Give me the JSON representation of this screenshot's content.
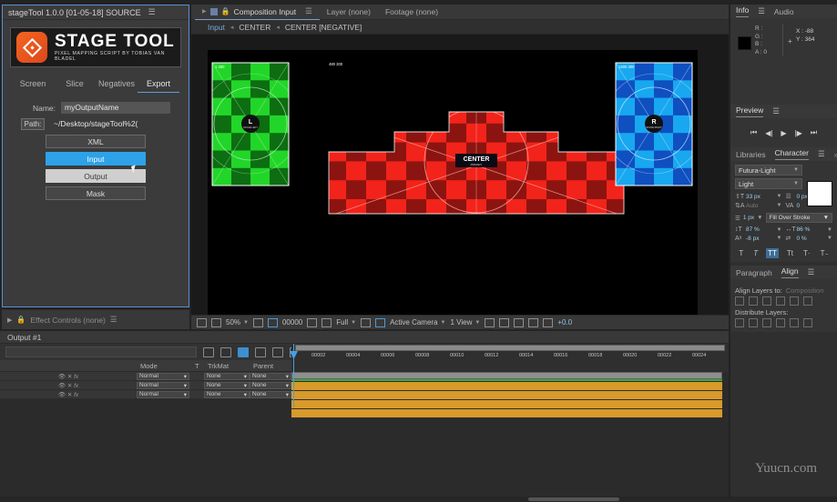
{
  "script_panel": {
    "title": "stageTool 1.0.0 [01-05-18] SOURCE",
    "menu_icon": "hamburger-icon",
    "logo": {
      "title": "STAGE TOOL",
      "subtitle": "PIXEL MAPPING SCRIPT BY TOBIAS VAN BLADEL"
    },
    "tabs": [
      {
        "label": "Screen",
        "active": false
      },
      {
        "label": "Slice",
        "active": false
      },
      {
        "label": "Negatives",
        "active": false
      },
      {
        "label": "Export",
        "active": true
      }
    ],
    "fields": [
      {
        "label": "Name:",
        "value": "myOutputName"
      },
      {
        "label": "Path:",
        "value": "~/Desktop/stageTool%2("
      }
    ],
    "buttons": [
      {
        "label": "XML",
        "style": "default"
      },
      {
        "label": "Input",
        "style": "blue"
      },
      {
        "label": "Output",
        "style": "light"
      },
      {
        "label": "Mask",
        "style": "default"
      }
    ]
  },
  "effect_controls": {
    "label": "Effect Controls (none)",
    "menu_icon": "hamburger-icon"
  },
  "comp_viewer": {
    "tabs": [
      {
        "label": "Composition Input",
        "active": true
      },
      {
        "label": "Layer (none)",
        "active": false
      },
      {
        "label": "Footage (none)",
        "active": false
      }
    ],
    "breadcrumb": [
      "Input",
      "CENTER",
      "CENTER [NEGATIVE]"
    ],
    "canvas": {
      "dimension_label": "480 300",
      "screens": [
        {
          "name": "green-screen-left",
          "label": "1 300",
          "badge_glyph": "L",
          "badge_caption": "STAGE LEFT",
          "color_light": "#22d629",
          "color_dark": "#0c6d11"
        },
        {
          "name": "red-screen-center",
          "label": "480 300",
          "tag_title": "CENTER",
          "tag_sub": "PRIMARY",
          "color_light": "#f2231a",
          "color_dark": "#8c1410"
        },
        {
          "name": "blue-screen-right",
          "label": "1400 300",
          "badge_glyph": "R",
          "badge_caption": "STAGE RIGHT",
          "color_light": "#18a8f0",
          "color_dark": "#0f4fc0"
        }
      ]
    },
    "toolbar": {
      "zoom": "50%",
      "timecode": "00000",
      "resolution": "Full",
      "camera": "Active Camera",
      "views": "1 View",
      "exposure": "+0.0"
    }
  },
  "timeline": {
    "tab_label": "Output #1",
    "columns": [
      "Mode",
      "T",
      "TrkMat",
      "Parent"
    ],
    "layers": [
      {
        "mode": "Normal",
        "trkmat": "None",
        "parent": "None"
      },
      {
        "mode": "Normal",
        "trkmat": "None",
        "parent": "None"
      },
      {
        "mode": "Normal",
        "trkmat": "None",
        "parent": "None"
      }
    ],
    "ruler_ticks": [
      "00002",
      "00004",
      "00006",
      "00008",
      "00010",
      "00012",
      "00014",
      "00016",
      "00018",
      "00020",
      "00022",
      "00024"
    ]
  },
  "info_panel": {
    "tabs": [
      {
        "label": "Info",
        "active": true
      },
      {
        "label": "Audio",
        "active": false
      }
    ],
    "channels": [
      "R :",
      "G :",
      "B :",
      "A : 0"
    ],
    "x_value": "X : -88",
    "y_value": "Y : 364"
  },
  "preview_panel": {
    "title": "Preview",
    "buttons": [
      "first-frame-icon",
      "prev-frame-icon",
      "play-icon",
      "next-frame-icon",
      "last-frame-icon"
    ]
  },
  "character_panel": {
    "tabs": [
      {
        "label": "Libraries",
        "active": false
      },
      {
        "label": "Character",
        "active": true
      }
    ],
    "font_family": "Futura-Light",
    "font_style": "Light",
    "font_size": "33 px",
    "leading": "Auto",
    "kerning": "0 px",
    "tracking": "0",
    "stroke_width": "1 px",
    "stroke_mode": "Fill Over Stroke",
    "vertical_scale": "87 %",
    "horizontal_scale": "86 %",
    "baseline_shift": "-8 px",
    "tsume": "0 %",
    "style_buttons": [
      "T",
      "T-italic",
      "TT",
      "Tt",
      "T-sup",
      "T-sub"
    ]
  },
  "paragraph_panel": {
    "tabs": [
      {
        "label": "Paragraph",
        "active": false
      },
      {
        "label": "Align",
        "active": true
      }
    ],
    "align_label": "Align Layers to:",
    "align_target": "Composition",
    "distribute_label": "Distribute Layers:"
  },
  "watermark": "Yuucn.com"
}
